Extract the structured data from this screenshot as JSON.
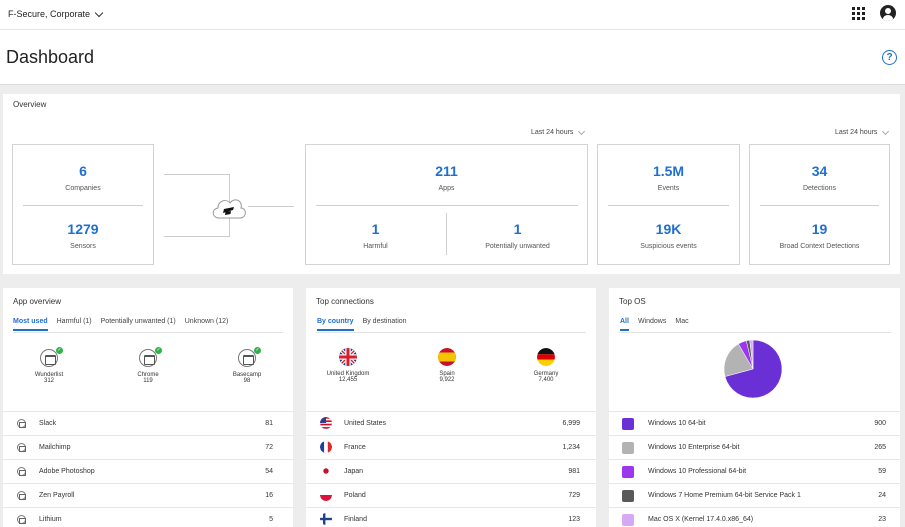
{
  "topbar": {
    "org_name": "F-Secure, Corporate",
    "icons": [
      "chevron-down-icon",
      "apps-grid-icon",
      "user-avatar-icon"
    ]
  },
  "header": {
    "title": "Dashboard",
    "help_icon": "?"
  },
  "overview": {
    "title": "Overview",
    "range_left": "Last 24 hours",
    "range_right": "Last 24 hours",
    "companies": {
      "value": "6",
      "label": "Companies"
    },
    "sensors": {
      "value": "1279",
      "label": "Sensors"
    },
    "apps": {
      "value": "211",
      "label": "Apps"
    },
    "harmful": {
      "value": "1",
      "label": "Harmful"
    },
    "potentially_unwanted": {
      "value": "1",
      "label": "Potentially unwanted"
    },
    "events": {
      "value": "1.5M",
      "label": "Events"
    },
    "suspicious_events": {
      "value": "19K",
      "label": "Suspicious events"
    },
    "detections": {
      "value": "34",
      "label": "Detections"
    },
    "bcd": {
      "value": "19",
      "label": "Broad Context Detections"
    }
  },
  "app_overview": {
    "title": "App overview",
    "tabs": [
      "Most used",
      "Harmful (1)",
      "Potentially unwanted (1)",
      "Unknown (12)"
    ],
    "featured": [
      {
        "name": "Wunderlist",
        "count": "312"
      },
      {
        "name": "Chrome",
        "count": "119"
      },
      {
        "name": "Basecamp",
        "count": "98"
      }
    ],
    "rows": [
      {
        "name": "Slack",
        "value": "81"
      },
      {
        "name": "Mailchimp",
        "value": "72"
      },
      {
        "name": "Adobe Photoshop",
        "value": "54"
      },
      {
        "name": "Zen Payroll",
        "value": "16"
      },
      {
        "name": "Lithium",
        "value": "5"
      }
    ]
  },
  "top_connections": {
    "title": "Top connections",
    "tabs": [
      "By country",
      "By destination"
    ],
    "featured": [
      {
        "name": "United Kingdom",
        "count": "12,455"
      },
      {
        "name": "Spain",
        "count": "9,922"
      },
      {
        "name": "Germany",
        "count": "7,400"
      }
    ],
    "rows": [
      {
        "name": "United States",
        "value": "6,999"
      },
      {
        "name": "France",
        "value": "1,234"
      },
      {
        "name": "Japan",
        "value": "981"
      },
      {
        "name": "Poland",
        "value": "729"
      },
      {
        "name": "Finland",
        "value": "123"
      }
    ]
  },
  "top_os": {
    "title": "Top OS",
    "tabs": [
      "All",
      "Windows",
      "Mac"
    ],
    "rows": [
      {
        "name": "Windows 10 64-bit",
        "value": "900",
        "color": "#6b2fd6"
      },
      {
        "name": "Windows 10 Enterprise 64-bit",
        "value": "265",
        "color": "#b3b3b3"
      },
      {
        "name": "Windows 10 Professional 64-bit",
        "value": "59",
        "color": "#9c36ef"
      },
      {
        "name": "Windows 7 Home Premium 64-bit Service Pack 1",
        "value": "24",
        "color": "#595959"
      },
      {
        "name": "Mac OS X (Kernel 17.4.0.x86_64)",
        "value": "23",
        "color": "#d7a9f4"
      }
    ]
  },
  "colors": {
    "accent": "#1f6fcf",
    "ok": "#2db34a"
  }
}
